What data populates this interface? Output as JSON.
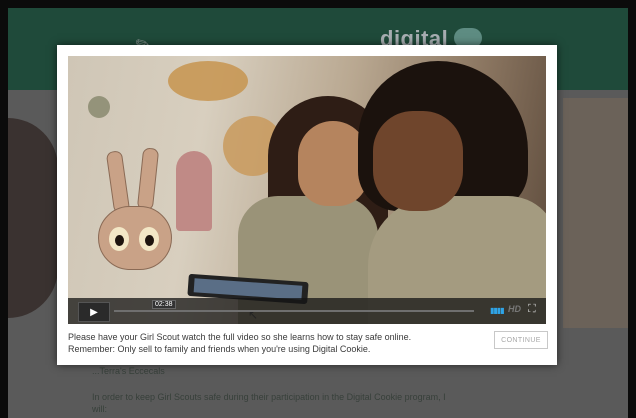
{
  "background": {
    "brand": "digital",
    "text_lines": [
      "...Terra's Eccecals",
      "In order to keep Girl Scouts safe during their participation in the Digital Cookie program, I",
      "will:"
    ]
  },
  "video": {
    "time_label": "02:38",
    "play_icon": "play-icon",
    "hd_label": "HD",
    "volume_icon": "volume-icon",
    "fullscreen_icon": "fullscreen-icon"
  },
  "modal": {
    "message_line1": "Please have your Girl Scout watch the full video so she learns how to stay safe online.",
    "message_line2": "Remember: Only sell to family and friends when you're using Digital Cookie.",
    "continue_label": "CONTINUE"
  },
  "colors": {
    "header_green": "#1f4a3a",
    "accent_blue": "#2fa4e7"
  }
}
